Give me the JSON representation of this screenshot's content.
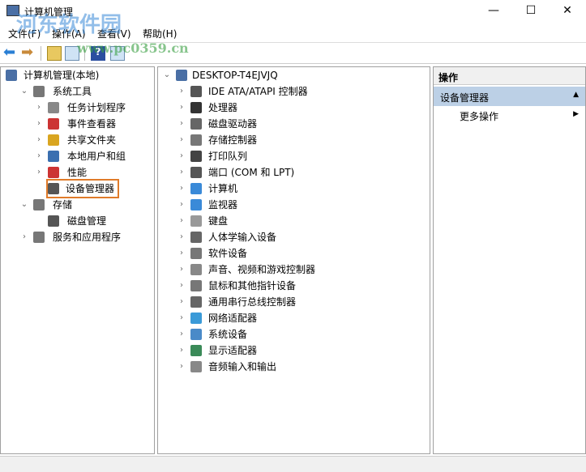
{
  "window": {
    "title": "计算机管理",
    "minimize": "—",
    "maximize": "☐",
    "close": "✕"
  },
  "menu": [
    "文件(F)",
    "操作(A)",
    "查看(V)",
    "帮助(H)"
  ],
  "watermark": {
    "site": "河东软件园",
    "url": "www.pc0359.cn"
  },
  "left_tree": [
    {
      "label": "计算机管理(本地)",
      "level": 0,
      "chev": "",
      "color": "#4a6fa5"
    },
    {
      "label": "系统工具",
      "level": 1,
      "chev": "⌄",
      "color": "#777"
    },
    {
      "label": "任务计划程序",
      "level": 2,
      "chev": "›",
      "color": "#888"
    },
    {
      "label": "事件查看器",
      "level": 2,
      "chev": "›",
      "color": "#c33"
    },
    {
      "label": "共享文件夹",
      "level": 2,
      "chev": "›",
      "color": "#d9a520"
    },
    {
      "label": "本地用户和组",
      "level": 2,
      "chev": "›",
      "color": "#3a6fb0"
    },
    {
      "label": "性能",
      "level": 2,
      "chev": "›",
      "color": "#c33"
    },
    {
      "label": "设备管理器",
      "level": 2,
      "chev": "",
      "color": "#555",
      "selected": true
    },
    {
      "label": "存储",
      "level": 1,
      "chev": "⌄",
      "color": "#777"
    },
    {
      "label": "磁盘管理",
      "level": 2,
      "chev": "",
      "color": "#555"
    },
    {
      "label": "服务和应用程序",
      "level": 1,
      "chev": "›",
      "color": "#777"
    }
  ],
  "device_tree": {
    "root": "DESKTOP-T4EJVJQ",
    "items": [
      "IDE ATA/ATAPI 控制器",
      "处理器",
      "磁盘驱动器",
      "存储控制器",
      "打印队列",
      "端口 (COM 和 LPT)",
      "计算机",
      "监视器",
      "键盘",
      "人体学输入设备",
      "软件设备",
      "声音、视频和游戏控制器",
      "鼠标和其他指针设备",
      "通用串行总线控制器",
      "网络适配器",
      "系统设备",
      "显示适配器",
      "音频输入和输出"
    ]
  },
  "actions": {
    "header": "操作",
    "section": "设备管理器",
    "section_arrow": "▲",
    "more": "更多操作",
    "more_arrow": "▶"
  }
}
